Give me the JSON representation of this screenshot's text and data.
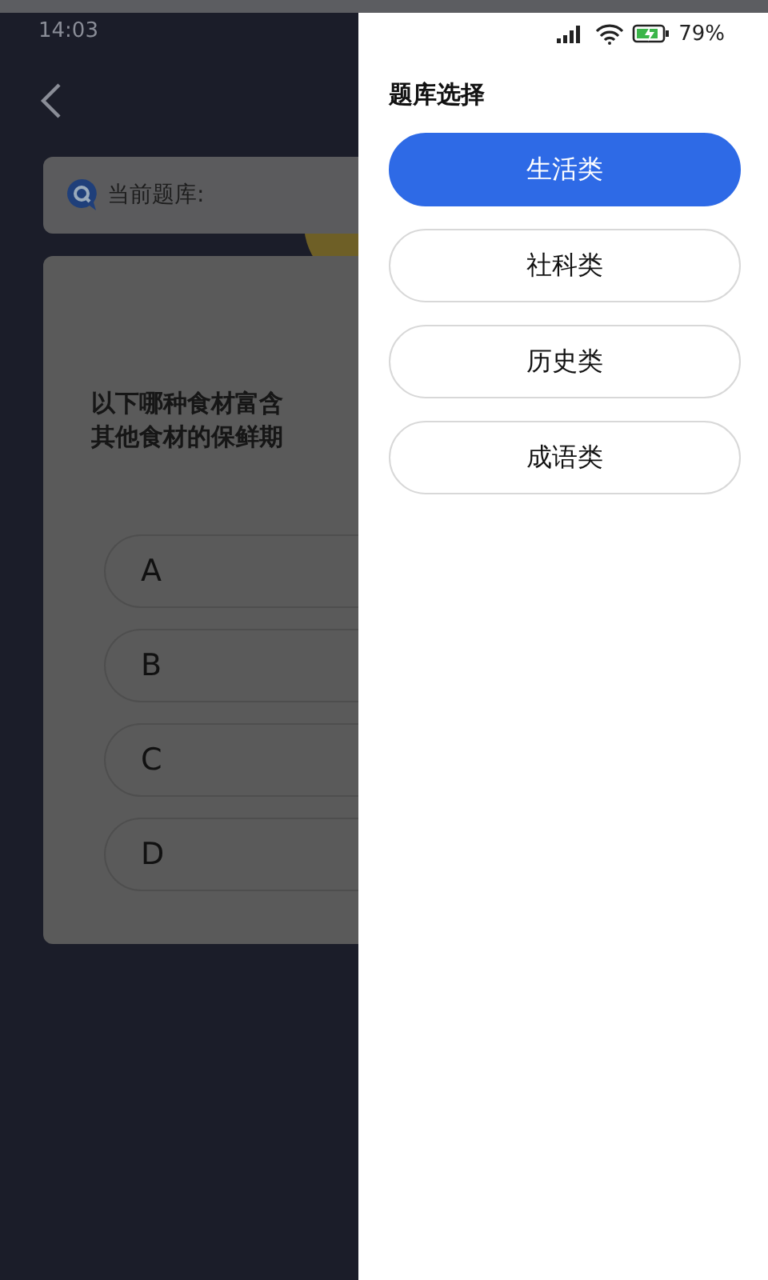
{
  "status_bar": {
    "time": "14:03",
    "battery": "79%"
  },
  "current_bank": {
    "label": "当前题库:"
  },
  "question": {
    "lines": [
      "以下哪种食材富含",
      "其他食材的保鲜期"
    ]
  },
  "options": [
    {
      "letter": "A"
    },
    {
      "letter": "B"
    },
    {
      "letter": "C"
    },
    {
      "letter": "D"
    }
  ],
  "drawer": {
    "title": "题库选择",
    "categories": [
      {
        "label": "生活类",
        "selected": true
      },
      {
        "label": "社科类",
        "selected": false
      },
      {
        "label": "历史类",
        "selected": false
      },
      {
        "label": "成语类",
        "selected": false
      }
    ]
  }
}
